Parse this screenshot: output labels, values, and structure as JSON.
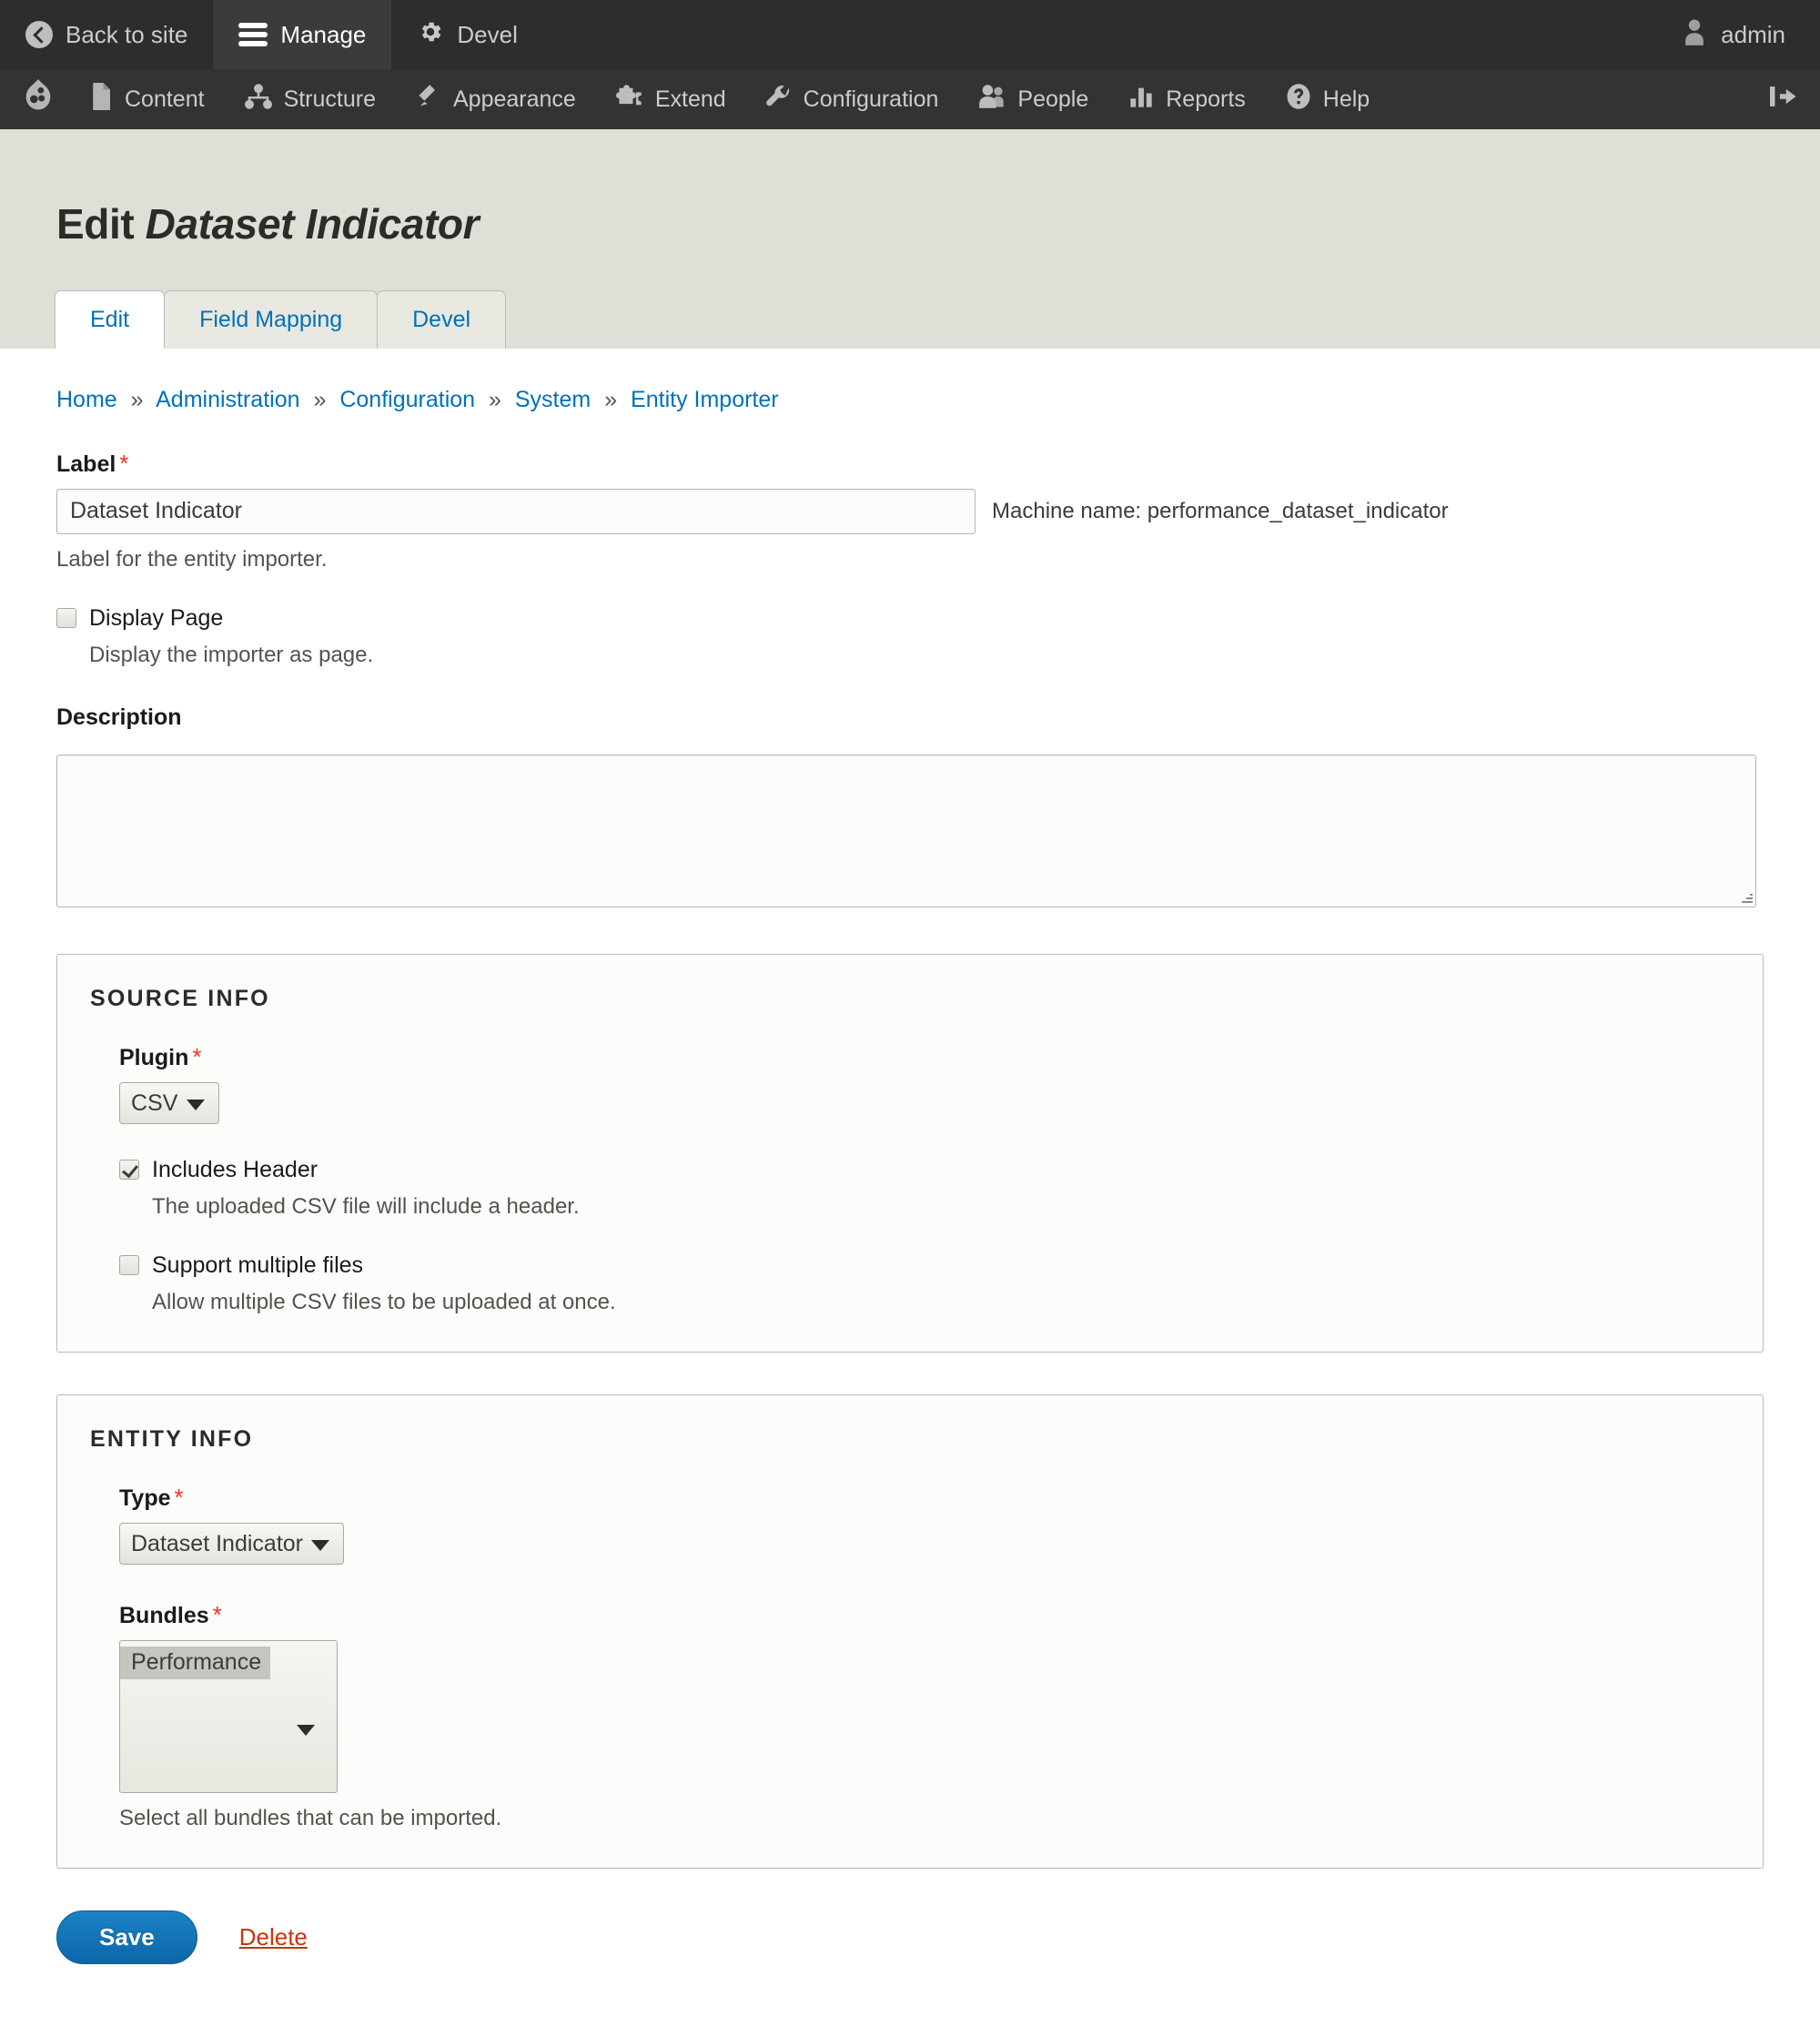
{
  "toolbar": {
    "back_to_site": "Back to site",
    "manage": "Manage",
    "devel": "Devel",
    "user": "admin"
  },
  "menu": {
    "items": [
      {
        "label": "Content",
        "icon": "document-icon"
      },
      {
        "label": "Structure",
        "icon": "structure-icon"
      },
      {
        "label": "Appearance",
        "icon": "paintbrush-icon"
      },
      {
        "label": "Extend",
        "icon": "puzzle-icon"
      },
      {
        "label": "Configuration",
        "icon": "wrench-icon"
      },
      {
        "label": "People",
        "icon": "people-icon"
      },
      {
        "label": "Reports",
        "icon": "bar-chart-icon"
      },
      {
        "label": "Help",
        "icon": "question-mark-icon"
      }
    ],
    "drupal_icon": "drupal-drop-icon",
    "orientation_toggle_icon": "toolbar-collapse-icon"
  },
  "page": {
    "title_prefix": "Edit",
    "title_entity": "Dataset Indicator"
  },
  "tabs": [
    {
      "label": "Edit",
      "active": true
    },
    {
      "label": "Field Mapping",
      "active": false
    },
    {
      "label": "Devel",
      "active": false
    }
  ],
  "breadcrumb": [
    "Home",
    "Administration",
    "Configuration",
    "System",
    "Entity Importer"
  ],
  "breadcrumb_separator": "»",
  "form": {
    "label": {
      "title": "Label",
      "required_mark": "*",
      "value": "Dataset Indicator",
      "machine_name": "Machine name: performance_dataset_indicator",
      "description": "Label for the entity importer."
    },
    "display_page": {
      "label": "Display Page",
      "checked": false,
      "description": "Display the importer as page."
    },
    "description_field": {
      "title": "Description",
      "value": ""
    },
    "source_info": {
      "legend": "SOURCE INFO",
      "plugin": {
        "title": "Plugin",
        "required_mark": "*",
        "value": "CSV",
        "options": [
          "CSV"
        ]
      },
      "includes_header": {
        "label": "Includes Header",
        "checked": true,
        "description": "The uploaded CSV file will include a header."
      },
      "support_multiple_files": {
        "label": "Support multiple files",
        "checked": false,
        "description": "Allow multiple CSV files to be uploaded at once."
      }
    },
    "entity_info": {
      "legend": "ENTITY INFO",
      "type": {
        "title": "Type",
        "required_mark": "*",
        "value": "Dataset Indicator",
        "options": [
          "Dataset Indicator"
        ]
      },
      "bundles": {
        "title": "Bundles",
        "required_mark": "*",
        "options": [
          "Performance"
        ],
        "selected": "Performance",
        "description": "Select all bundles that can be imported."
      }
    },
    "actions": {
      "save_label": "Save",
      "delete_label": "Delete"
    }
  },
  "colors": {
    "toolbar_bg": "#2d2d2d",
    "toolbar_tab_active_bg": "#3b3b3b",
    "menu_bg": "#333333",
    "page_head_bg": "#dfdfd7",
    "link_blue": "#0071b8",
    "required_red": "#ee3322",
    "delete_red": "#c8350a",
    "save_blue": "#0c67a8"
  }
}
